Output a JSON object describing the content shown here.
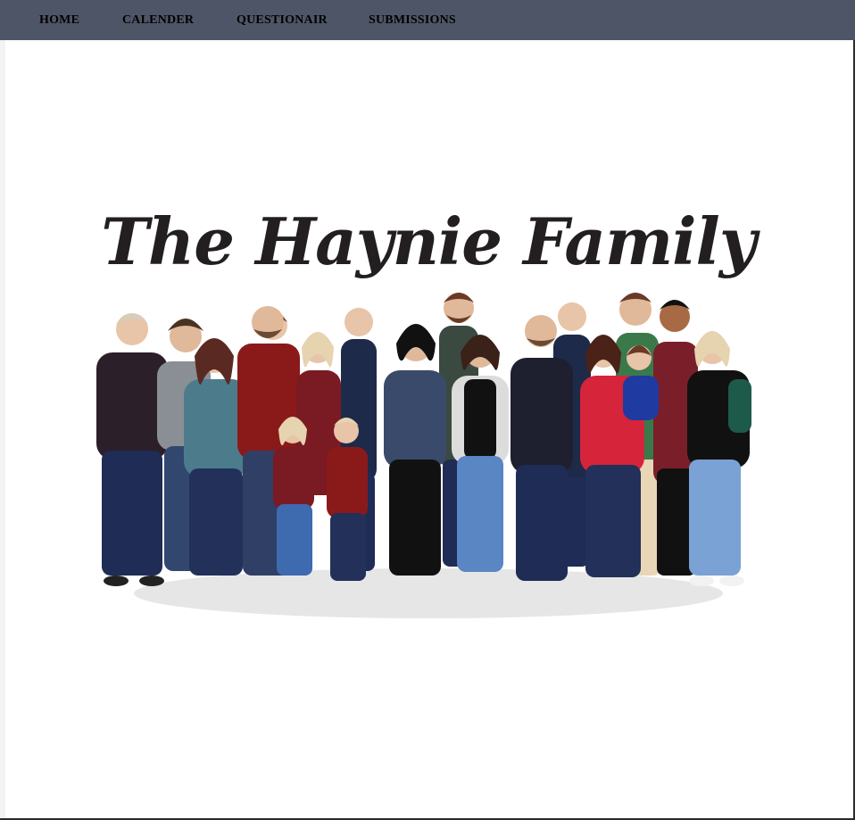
{
  "nav": {
    "items": [
      {
        "label": "HOME"
      },
      {
        "label": "CALENDER"
      },
      {
        "label": "QUESTIONAIR"
      },
      {
        "label": "SUBMISSIONS"
      }
    ]
  },
  "hero": {
    "title": "The Haynie Family"
  },
  "colors": {
    "navbar": "#4e5566",
    "nav_text": "#000000",
    "background": "#ffffff",
    "title": "#231f20"
  }
}
